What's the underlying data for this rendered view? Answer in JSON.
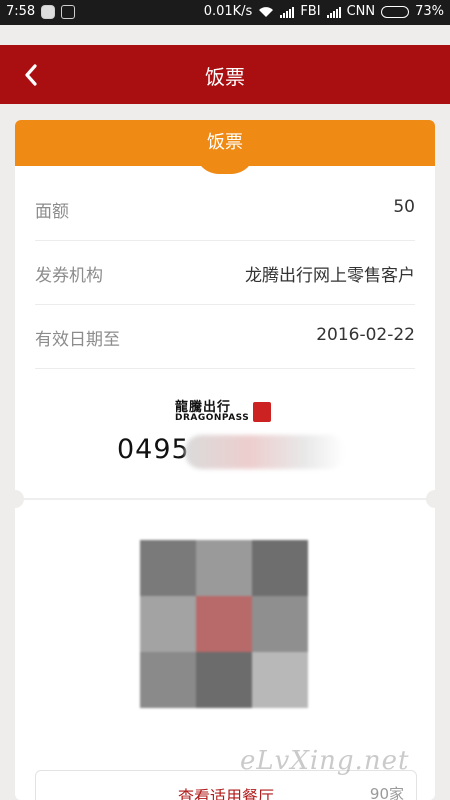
{
  "status_bar": {
    "time": "7:58",
    "speed": "0.01K/s",
    "carrier1": "FBI",
    "carrier2": "CNN",
    "battery": "73%",
    "battery_level": 0.73,
    "icons": [
      "qq-icon",
      "notification-icon",
      "wifi-icon",
      "signal-icon",
      "battery-icon"
    ]
  },
  "header": {
    "title": "饭票",
    "back_icon": "chevron-left-icon"
  },
  "ticket": {
    "title": "饭票",
    "rows": [
      {
        "label": "面额",
        "value": "50"
      },
      {
        "label": "发券机构",
        "value": "龙腾出行网上零售客户"
      },
      {
        "label": "有效日期至",
        "value": "2016-02-22"
      }
    ],
    "logo": {
      "cn": "龍騰出行",
      "en": "DRAGONPASS"
    },
    "code_prefix": "0495",
    "button": {
      "label": "查看适用餐厅",
      "count": "90家"
    }
  },
  "watermark": "eLvXing.net",
  "colors": {
    "header": "#a90e10",
    "ticket_head": "#ef8a15",
    "accent_text": "#b11b1b"
  }
}
